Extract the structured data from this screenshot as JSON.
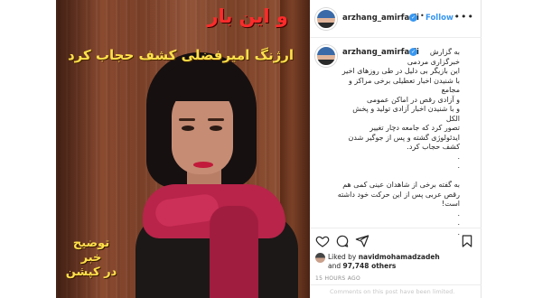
{
  "photo": {
    "title": "و این بار",
    "subtitle": "ارژنگ امیرفضلی کشف حجاب کرد",
    "note_lines": [
      "توضیح",
      "خبر",
      "در کپشن"
    ]
  },
  "post": {
    "username": "arzhang_amirfazli",
    "follow_label": "Follow",
    "more_label": "•••",
    "caption_lines": [
      "به گزارش",
      "خبرگزاری مردمی",
      "این بازیگر بی دلیل در طی روزهای اخیر",
      "با شنیدن اخبار تعطیلی برخی مراکز و",
      "مجامع",
      "و آزادی رقص در اماکن عمومی",
      "و با شنیدن اخبار آزادی تولید و پخش",
      "الکل",
      "تصور کرد که جامعه دچار تغییر",
      "ایدئولوژی گشته و پس از جوگیر شدن",
      "کشف حجاب کرد.",
      ".",
      ".",
      "",
      "به گفته برخی از شاهدان عینی کمی هم",
      "رقص عربی پس از این حرکت خود داشته",
      "است!",
      ".",
      ".",
      "."
    ],
    "liked_by_prefix": "Liked by",
    "liked_by_user": "navidmohamadzadeh",
    "liked_and": "and",
    "liked_count": "97,748 others",
    "time_ago": "15 HOURS AGO",
    "comment_placeholder": "Comments on this post have been limited."
  },
  "colors": {
    "verified": "#3897f0",
    "follow": "#3897f0",
    "title_red": "#ff2b2b",
    "subtitle_yellow": "#ffe14a"
  },
  "icons": [
    "verified-badge-icon",
    "heart-icon",
    "comment-icon",
    "share-icon",
    "bookmark-icon",
    "more-icon"
  ]
}
